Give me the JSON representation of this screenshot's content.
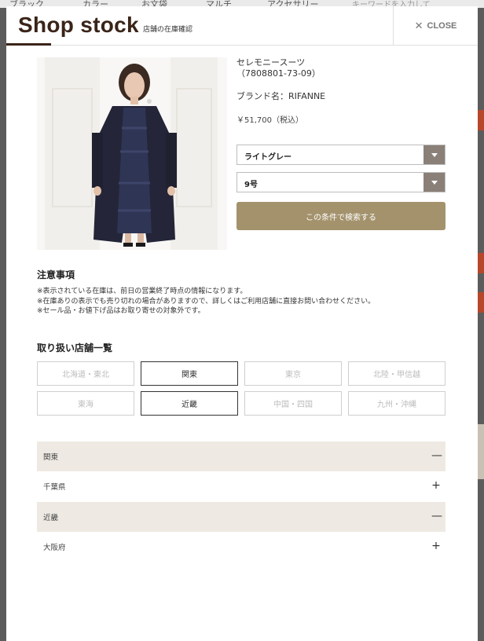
{
  "background": {
    "nav_items": [
      "ブラック",
      "カラー",
      "お文袋",
      "マルチ",
      "アクセサリー",
      "キーワードを入力して"
    ]
  },
  "modal": {
    "title": "Shop stock",
    "subtitle": "店舗の在庫確認",
    "close_label": "CLOSE",
    "close_icon": "close-icon"
  },
  "product": {
    "name": "セレモニースーツ",
    "code": "（7808801-73-09）",
    "brand": "ブランド名：RIFANNE",
    "price": "￥51,700（税込）",
    "color_select": "ライトグレー",
    "size_select": "9号",
    "search_button": "この条件で検索する"
  },
  "notes": {
    "heading": "注意事項",
    "lines": [
      "※表示されている在庫は、前日の営業終了時点の情報になります。",
      "※在庫ありの表示でも売り切れの場合がありますので、詳しくはご利用店舗に直接お問い合わせください。",
      "※セール品・お値下げ品はお取り寄せの対象外です。"
    ]
  },
  "stores": {
    "heading": "取り扱い店舗一覧",
    "regions": [
      {
        "label": "北海道・東北",
        "active": false
      },
      {
        "label": "関東",
        "active": true
      },
      {
        "label": "東京",
        "active": false
      },
      {
        "label": "北陸・甲信越",
        "active": false
      },
      {
        "label": "東海",
        "active": false
      },
      {
        "label": "近畿",
        "active": true
      },
      {
        "label": "中国・四国",
        "active": false
      },
      {
        "label": "九州・沖縄",
        "active": false
      }
    ],
    "accordion": [
      {
        "label": "関東",
        "type": "head",
        "sign": "—"
      },
      {
        "label": "千葉県",
        "type": "sub",
        "sign": "+"
      },
      {
        "label": "近畿",
        "type": "head",
        "sign": "—"
      },
      {
        "label": "大阪府",
        "type": "sub",
        "sign": "+"
      }
    ]
  },
  "colors": {
    "brand_dark": "#3a2418",
    "button_gold": "#a3926c",
    "select_arrow": "#8a8078",
    "accordion_head": "#eeeae3"
  }
}
